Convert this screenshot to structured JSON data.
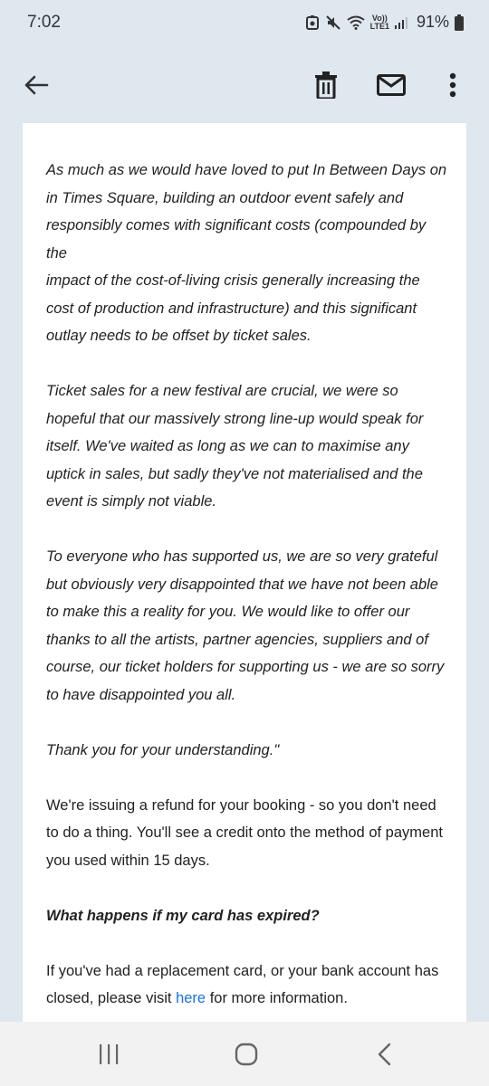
{
  "status_bar": {
    "time": "7:02",
    "network": "Vo))\nLTE1",
    "battery": "91%"
  },
  "app_bar": {
    "icons": [
      "back-arrow-icon",
      "trash-icon",
      "mail-icon",
      "more-vert-icon"
    ]
  },
  "email": {
    "quote_p1_lines": [
      "As much as we would have loved to put In Between Days on",
      "in Times Square, building an outdoor event safely and",
      "responsibly comes with significant costs (compounded by",
      "the",
      "impact of the cost-of-living crisis generally increasing the",
      "cost of production and infrastructure) and this significant",
      "outlay needs to be offset by ticket sales."
    ],
    "quote_p2": "Ticket sales for a new festival are crucial, we were so hopeful that our massively strong line-up would speak for itself. We've waited as long as we can to maximise any uptick in sales, but sadly they've not materialised and the event is simply not viable.",
    "quote_p3": "To everyone who has supported us, we are so very grateful but obviously very disappointed that we have not been able to make this a reality for you. We would like to offer our thanks to all the artists, partner agencies, suppliers and of course, our ticket holders for supporting us - we are so sorry to have disappointed you all.",
    "quote_p4": "Thank you for your understanding.\"",
    "refund_p": "We're issuing a refund for your booking - so you don't need to do a thing. You'll see a credit onto the method of payment you used within 15 days.",
    "heading": "What happens if my card has expired?",
    "expired_before": "If you've had a replacement card, or your bank account has closed, please visit ",
    "expired_link": "here",
    "expired_after": " for more information."
  },
  "nav_bar": {
    "icons": [
      "recent-apps-icon",
      "home-icon",
      "back-icon"
    ]
  },
  "colors": {
    "header_bg": "#dfe7ef",
    "link": "#1a73e8"
  }
}
